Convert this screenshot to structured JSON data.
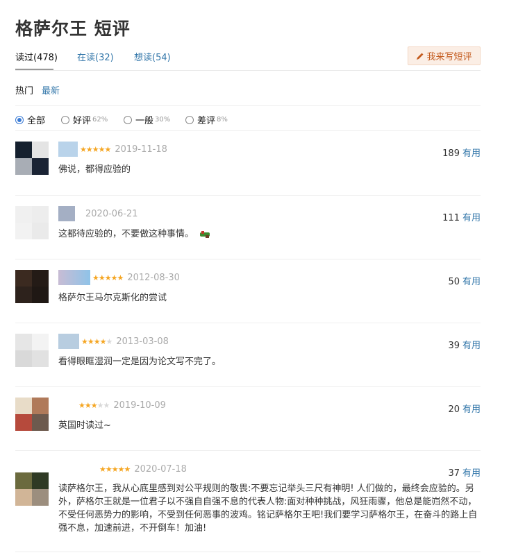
{
  "page": {
    "title": "格萨尔王 短评"
  },
  "tabs": [
    {
      "label": "读过(478)"
    },
    {
      "label": "在读(32)"
    },
    {
      "label": "想读(54)"
    }
  ],
  "write_button": {
    "label": "我来写短评",
    "icon": "pencil-icon"
  },
  "sort": {
    "hot": "热门",
    "new": "最新"
  },
  "filters": [
    {
      "label": "全部",
      "pct": "",
      "checked": true
    },
    {
      "label": "好评",
      "pct": "62%",
      "checked": false
    },
    {
      "label": "一般",
      "pct": "30%",
      "checked": false
    },
    {
      "label": "差评",
      "pct": "8%",
      "checked": false
    }
  ],
  "useful_label": "有用",
  "colors": {
    "link": "#3377aa",
    "star": "#f5a623",
    "write_btn_text": "#c35a1d",
    "write_btn_bg": "#fbeee5"
  },
  "comments": [
    {
      "stars": 5,
      "date": "2019-11-18",
      "votes": "189",
      "text": "佛说，都得应验的"
    },
    {
      "stars": 0,
      "date": "2020-06-21",
      "votes": "111",
      "text": "这都待应验的，不要做这种事情。"
    },
    {
      "stars": 5,
      "date": "2012-08-30",
      "votes": "50",
      "text": "格萨尔王马尔克斯化的尝试"
    },
    {
      "stars": 4,
      "date": "2013-03-08",
      "votes": "39",
      "text": "看得眼眶湿润一定是因为论文写不完了。"
    },
    {
      "stars": 3,
      "date": "2019-10-09",
      "votes": "20",
      "text": "英国时读过~"
    },
    {
      "stars": 5,
      "date": "2020-07-18",
      "votes": "37",
      "text": "读萨格尔王，我从心底里感到对公平规则的敬畏:不要忘记举头三尺有神明! 人们做的，最终会应验的。另外，萨格尔王就是一位君子以不强自自强不息的代表人物:面对种种挑战，风狂雨骤，他总是能岿然不动，不受任何恶势力的影响，不受到任何恶事的波鸡。铭记萨格尔王吧!我们要学习萨格尔王，在奋斗的路上自强不息，加速前进，不开倒车！加油!"
    }
  ]
}
